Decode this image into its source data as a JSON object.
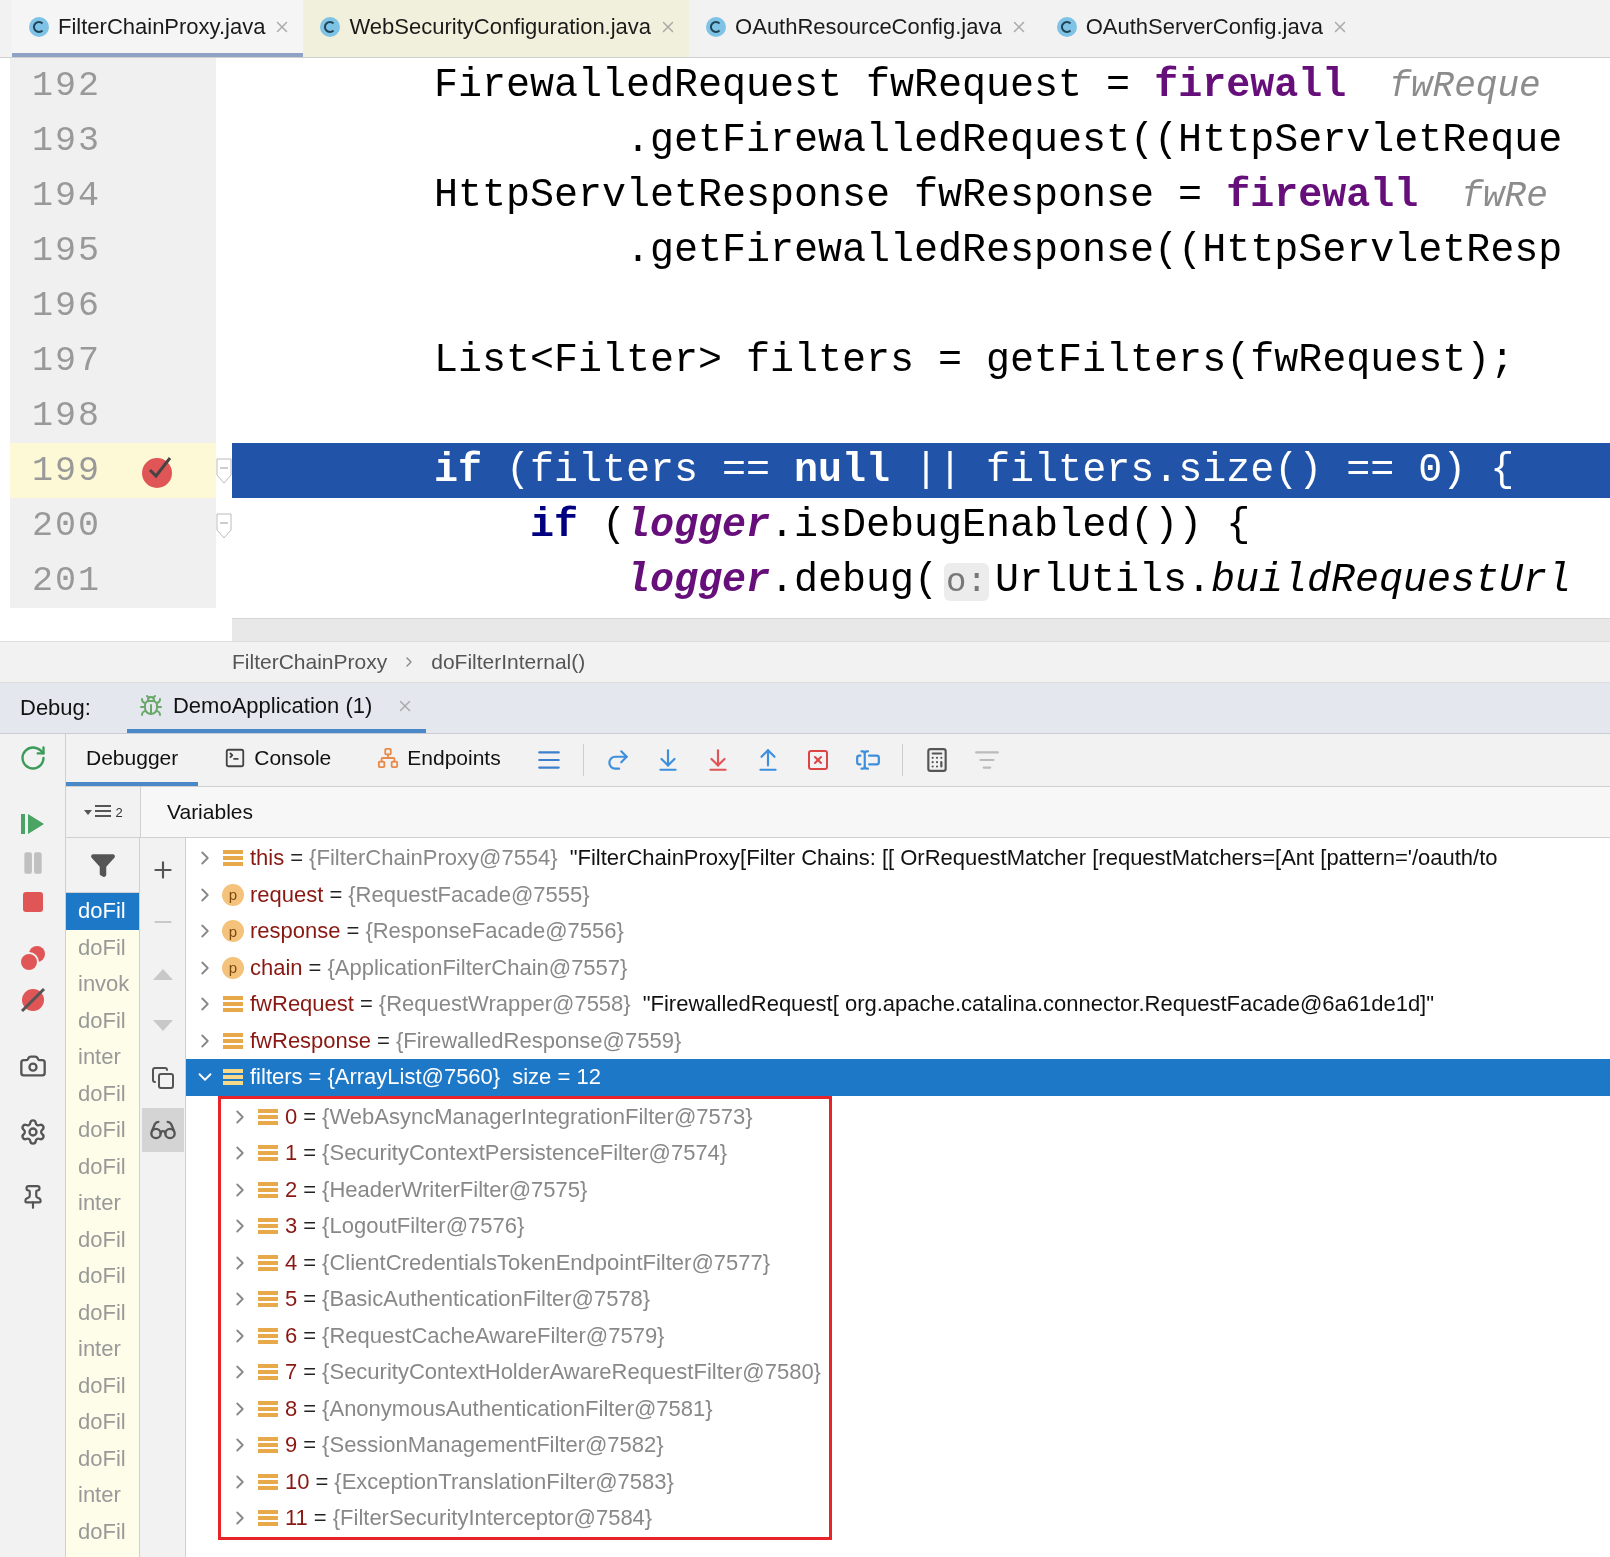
{
  "editor_tabs": [
    {
      "label": "FilterChainProxy.java",
      "selected": true,
      "color": "#f5f5f5"
    },
    {
      "label": "WebSecurityConfiguration.java",
      "selected": false,
      "color": "#f1f0dc"
    },
    {
      "label": "OAuthResourceConfig.java",
      "selected": false,
      "color": "#f2f2f2"
    },
    {
      "label": "OAuthServerConfig.java",
      "selected": false,
      "color": "#f2f2f2"
    }
  ],
  "code": {
    "lines": [
      {
        "number": "192",
        "current": false,
        "breakpoint": false,
        "fold": false,
        "tokens": [
          {
            "kind": "plain",
            "text": "FirewalledRequest fwRequest = "
          },
          {
            "kind": "field",
            "text": "firewall"
          },
          {
            "kind": "hint",
            "text": "  fwReque"
          }
        ]
      },
      {
        "number": "193",
        "current": false,
        "breakpoint": false,
        "fold": false,
        "tokens": [
          {
            "kind": "plain",
            "text": "        .getFirewalledRequest((HttpServletReque"
          }
        ]
      },
      {
        "number": "194",
        "current": false,
        "breakpoint": false,
        "fold": false,
        "tokens": [
          {
            "kind": "plain",
            "text": "HttpServletResponse fwResponse = "
          },
          {
            "kind": "field",
            "text": "firewall"
          },
          {
            "kind": "hint",
            "text": "  fwRe"
          }
        ]
      },
      {
        "number": "195",
        "current": false,
        "breakpoint": false,
        "fold": false,
        "tokens": [
          {
            "kind": "plain",
            "text": "        .getFirewalledResponse((HttpServletResp"
          }
        ]
      },
      {
        "number": "196",
        "current": false,
        "breakpoint": false,
        "fold": false
      },
      {
        "number": "197",
        "current": false,
        "breakpoint": false,
        "fold": false,
        "tokens": [
          {
            "kind": "plain",
            "text": "List<Filter> filters = getFilters(fwRequest);"
          }
        ]
      },
      {
        "number": "198",
        "current": false,
        "breakpoint": false,
        "fold": false
      },
      {
        "number": "199",
        "current": true,
        "breakpoint": true,
        "fold": true,
        "tokens": [
          {
            "kind": "keyword",
            "text": "if"
          },
          {
            "kind": "plain",
            "text": " (filters == "
          },
          {
            "kind": "keyword",
            "text": "null"
          },
          {
            "kind": "plain",
            "text": " || filters.size() == 0) {"
          }
        ]
      },
      {
        "number": "200",
        "current": false,
        "breakpoint": false,
        "fold": true,
        "tokens": [
          {
            "kind": "keyword",
            "text": "    if"
          },
          {
            "kind": "plain",
            "text": " ("
          },
          {
            "kind": "static",
            "text": "logger"
          },
          {
            "kind": "plain",
            "text": ".isDebugEnabled()) {"
          }
        ]
      },
      {
        "number": "201",
        "current": false,
        "breakpoint": false,
        "fold": false,
        "tokens": [
          {
            "kind": "static",
            "text": "        logger"
          },
          {
            "kind": "plain",
            "text": ".debug("
          },
          {
            "kind": "hintbox",
            "text": "o:"
          },
          {
            "kind": "plain",
            "text": "UrlUtils."
          },
          {
            "kind": "italic",
            "text": "buildRequestUrl"
          }
        ]
      }
    ]
  },
  "breadcrumbs": [
    "FilterChainProxy",
    "doFilterInternal()"
  ],
  "debug": {
    "label": "Debug:",
    "session": {
      "label": "DemoApplication (1)",
      "selected": true
    }
  },
  "debug_tabs": [
    {
      "label": "Debugger",
      "selected": true,
      "kind": "debugger"
    },
    {
      "label": "Console",
      "selected": false,
      "kind": "console"
    },
    {
      "label": "Endpoints",
      "selected": false,
      "kind": "endpoints"
    }
  ],
  "frames": {
    "layout_badge": "2",
    "items": [
      {
        "label": "doFil",
        "selected": true
      },
      {
        "label": "doFil",
        "selected": false
      },
      {
        "label": "invok",
        "selected": false
      },
      {
        "label": "doFil",
        "selected": false
      },
      {
        "label": "inter",
        "selected": false
      },
      {
        "label": "doFil",
        "selected": false
      },
      {
        "label": "doFil",
        "selected": false
      },
      {
        "label": "doFil",
        "selected": false
      },
      {
        "label": "inter",
        "selected": false
      },
      {
        "label": "doFil",
        "selected": false
      },
      {
        "label": "doFil",
        "selected": false
      },
      {
        "label": "doFil",
        "selected": false
      },
      {
        "label": "inter",
        "selected": false
      },
      {
        "label": "doFil",
        "selected": false
      },
      {
        "label": "doFil",
        "selected": false
      },
      {
        "label": "doFil",
        "selected": false
      },
      {
        "label": "inter",
        "selected": false
      },
      {
        "label": "doFil",
        "selected": false
      }
    ]
  },
  "variables": {
    "title": "Variables",
    "equals": "=",
    "items": [
      {
        "kind": "field",
        "name": "this",
        "type": "{FilterChainProxy@7554}",
        "value": "\"FilterChainProxy[Filter Chains: [[ OrRequestMatcher [requestMatchers=[Ant [pattern='/oauth/to",
        "expanded": false,
        "selected": false
      },
      {
        "kind": "param",
        "badge": "p",
        "name": "request",
        "type": "{RequestFacade@7555}",
        "expanded": false,
        "selected": false
      },
      {
        "kind": "param",
        "badge": "p",
        "name": "response",
        "type": "{ResponseFacade@7556}",
        "expanded": false,
        "selected": false
      },
      {
        "kind": "param",
        "badge": "p",
        "name": "chain",
        "type": "{ApplicationFilterChain@7557}",
        "expanded": false,
        "selected": false
      },
      {
        "kind": "field",
        "name": "fwRequest",
        "type": "{RequestWrapper@7558}",
        "value": "\"FirewalledRequest[ org.apache.catalina.connector.RequestFacade@6a61de1d]\"",
        "expanded": false,
        "selected": false
      },
      {
        "kind": "field",
        "name": "fwResponse",
        "type": "{FirewalledResponse@7559}",
        "expanded": false,
        "selected": false
      },
      {
        "kind": "field",
        "name": "filters",
        "type": "{ArrayList@7560}",
        "value": "size = 12",
        "expanded": true,
        "selected": true,
        "children": [
          {
            "kind": "field",
            "name": "0",
            "type": "{WebAsyncManagerIntegrationFilter@7573}",
            "expanded": false,
            "selected": false
          },
          {
            "kind": "field",
            "name": "1",
            "type": "{SecurityContextPersistenceFilter@7574}",
            "expanded": false,
            "selected": false
          },
          {
            "kind": "field",
            "name": "2",
            "type": "{HeaderWriterFilter@7575}",
            "expanded": false,
            "selected": false
          },
          {
            "kind": "field",
            "name": "3",
            "type": "{LogoutFilter@7576}",
            "expanded": false,
            "selected": false
          },
          {
            "kind": "field",
            "name": "4",
            "type": "{ClientCredentialsTokenEndpointFilter@7577}",
            "expanded": false,
            "selected": false
          },
          {
            "kind": "field",
            "name": "5",
            "type": "{BasicAuthenticationFilter@7578}",
            "expanded": false,
            "selected": false
          },
          {
            "kind": "field",
            "name": "6",
            "type": "{RequestCacheAwareFilter@7579}",
            "expanded": false,
            "selected": false
          },
          {
            "kind": "field",
            "name": "7",
            "type": "{SecurityContextHolderAwareRequestFilter@7580}",
            "expanded": false,
            "selected": false
          },
          {
            "kind": "field",
            "name": "8",
            "type": "{AnonymousAuthenticationFilter@7581}",
            "expanded": false,
            "selected": false
          },
          {
            "kind": "field",
            "name": "9",
            "type": "{SessionManagementFilter@7582}",
            "expanded": false,
            "selected": false
          },
          {
            "kind": "field",
            "name": "10",
            "type": "{ExceptionTranslationFilter@7583}",
            "expanded": false,
            "selected": false
          },
          {
            "kind": "field",
            "name": "11",
            "type": "{FilterSecurityInterceptor@7584}",
            "expanded": false,
            "selected": false
          }
        ]
      }
    ]
  }
}
